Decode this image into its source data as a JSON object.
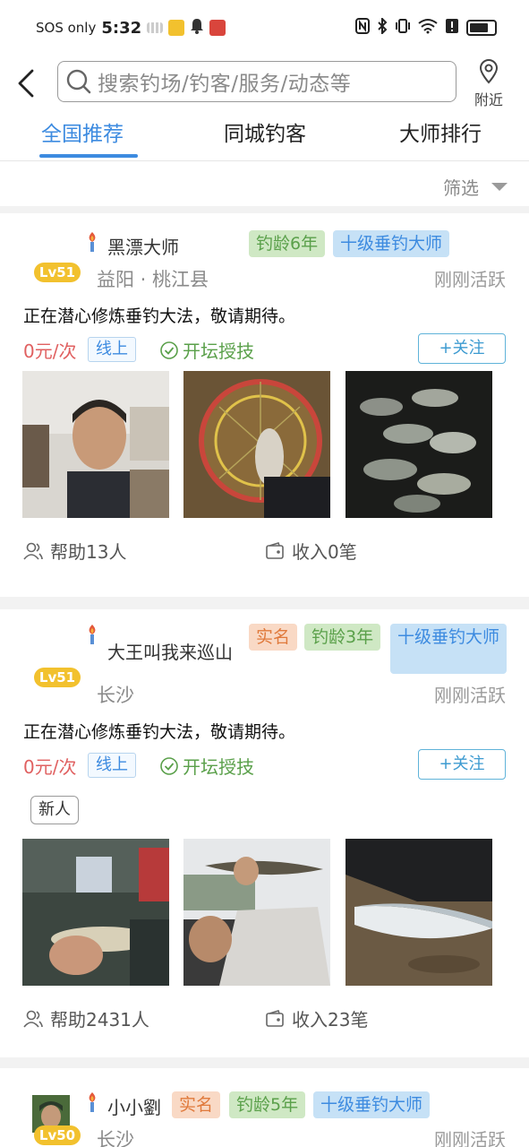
{
  "status_bar": {
    "carrier": "SOS only",
    "time": "5:32",
    "signal_extra": "6"
  },
  "header": {
    "search_placeholder": "搜索钓场/钓客/服务/动态等",
    "nearby_label": "附近"
  },
  "tabs": [
    {
      "label": "全国推荐",
      "active": true
    },
    {
      "label": "同城钓客",
      "active": false
    },
    {
      "label": "大师排行",
      "active": false
    }
  ],
  "filter": {
    "label": "筛选"
  },
  "cards": [
    {
      "level": "Lv51",
      "name": "黑漂大师",
      "tags": [
        {
          "type": "age",
          "label": "钓龄6年"
        },
        {
          "type": "master",
          "label": "十级垂钓大师"
        }
      ],
      "location": "益阳 · 桃江县",
      "active": "刚刚活跃",
      "motto": "正在潜心修炼垂钓大法，敬请期待。",
      "price": "0元/次",
      "mode": "线上",
      "teach": "开坛授技",
      "follow": "+关注",
      "help": "帮助13人",
      "income": "收入0笔"
    },
    {
      "level": "Lv51",
      "name": "大王叫我来巡山",
      "tags": [
        {
          "type": "real",
          "label": "实名"
        },
        {
          "type": "age",
          "label": "钓龄3年"
        },
        {
          "type": "master",
          "label": "十级垂钓大师"
        }
      ],
      "location": "长沙",
      "active": "刚刚活跃",
      "motto": "正在潜心修炼垂钓大法，敬请期待。",
      "price": "0元/次",
      "mode": "线上",
      "teach": "开坛授技",
      "follow": "+关注",
      "badge": "新人",
      "help": "帮助2431人",
      "income": "收入23笔"
    },
    {
      "level": "Lv50",
      "name": "小小劉",
      "tags": [
        {
          "type": "real",
          "label": "实名"
        },
        {
          "type": "age",
          "label": "钓龄5年"
        },
        {
          "type": "master",
          "label": "十级垂钓大师"
        }
      ],
      "location": "长沙",
      "active": "刚刚活跃"
    }
  ],
  "colors": {
    "accent": "#3d8be0",
    "price": "#e06060",
    "teach": "#5aa04a",
    "level": "#f2c12e"
  }
}
